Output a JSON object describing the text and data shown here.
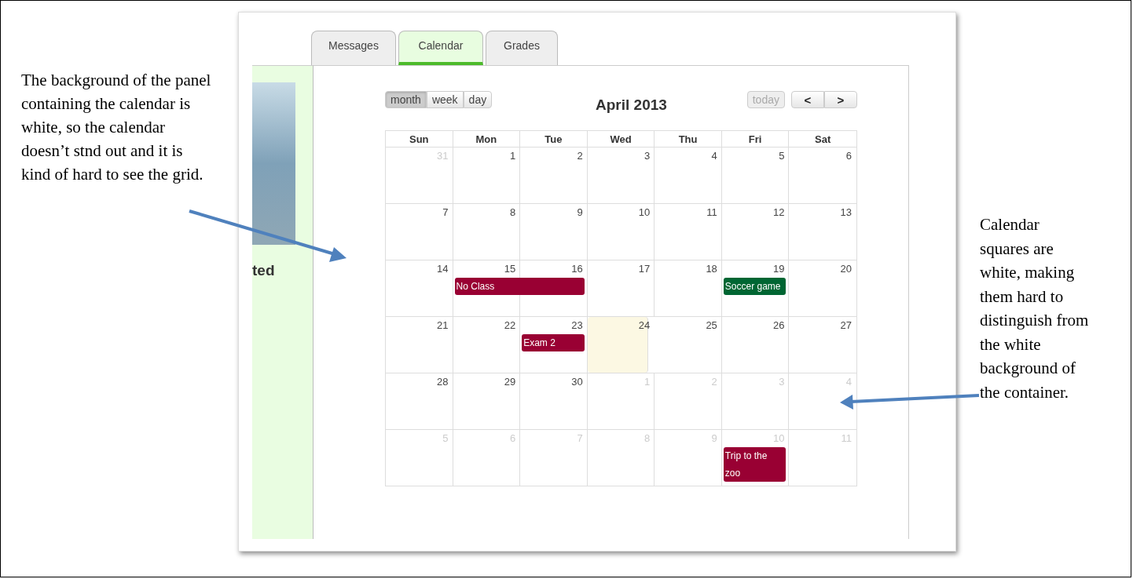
{
  "annotations": [
    {
      "text": "The background of the panel containing the calendar is white, so the calendar doesn’t stnd out and it is kind of hard to see the grid."
    },
    {
      "text": "Calendar squares are white, making them hard to distinguish from the white background of the container."
    }
  ],
  "tabs": [
    {
      "label": "Messages",
      "selected": false
    },
    {
      "label": "Calendar",
      "selected": true
    },
    {
      "label": "Grades",
      "selected": false
    }
  ],
  "sidebar": {
    "heading": "ted"
  },
  "calendar": {
    "view_buttons": [
      {
        "label": "month",
        "selected": true
      },
      {
        "label": "week",
        "selected": false
      },
      {
        "label": "day",
        "selected": false
      }
    ],
    "title": "April 2013",
    "today_button": {
      "label": "today",
      "disabled": true
    },
    "prev_button": "<",
    "next_button": ">",
    "weekdays": [
      "Sun",
      "Mon",
      "Tue",
      "Wed",
      "Thu",
      "Fri",
      "Sat"
    ],
    "weeks": [
      {
        "days": [
          {
            "day": "31",
            "other_month": true,
            "today": false
          },
          {
            "day": "1",
            "other_month": false,
            "today": false
          },
          {
            "day": "2",
            "other_month": false,
            "today": false
          },
          {
            "day": "3",
            "other_month": false,
            "today": false
          },
          {
            "day": "4",
            "other_month": false,
            "today": false
          },
          {
            "day": "5",
            "other_month": false,
            "today": false
          },
          {
            "day": "6",
            "other_month": false,
            "today": false
          }
        ]
      },
      {
        "days": [
          {
            "day": "7",
            "other_month": false,
            "today": false
          },
          {
            "day": "8",
            "other_month": false,
            "today": false
          },
          {
            "day": "9",
            "other_month": false,
            "today": false
          },
          {
            "day": "10",
            "other_month": false,
            "today": false
          },
          {
            "day": "11",
            "other_month": false,
            "today": false
          },
          {
            "day": "12",
            "other_month": false,
            "today": false
          },
          {
            "day": "13",
            "other_month": false,
            "today": false
          }
        ]
      },
      {
        "days": [
          {
            "day": "14",
            "other_month": false,
            "today": false
          },
          {
            "day": "15",
            "other_month": false,
            "today": false,
            "event": {
              "title": "No Class",
              "color": "#990033",
              "continues_next_day": true
            }
          },
          {
            "day": "16",
            "other_month": false,
            "today": false
          },
          {
            "day": "17",
            "other_month": false,
            "today": false
          },
          {
            "day": "18",
            "other_month": false,
            "today": false
          },
          {
            "day": "19",
            "other_month": false,
            "today": false,
            "event": {
              "title": "Soccer game",
              "color": "#006633",
              "continues_next_day": false
            }
          },
          {
            "day": "20",
            "other_month": false,
            "today": false
          }
        ]
      },
      {
        "days": [
          {
            "day": "21",
            "other_month": false,
            "today": false
          },
          {
            "day": "22",
            "other_month": false,
            "today": false
          },
          {
            "day": "23",
            "other_month": false,
            "today": false,
            "event": {
              "title": "Exam 2",
              "color": "#990033",
              "continues_next_day": false
            }
          },
          {
            "day": "24",
            "other_month": false,
            "today": true
          },
          {
            "day": "25",
            "other_month": false,
            "today": false
          },
          {
            "day": "26",
            "other_month": false,
            "today": false
          },
          {
            "day": "27",
            "other_month": false,
            "today": false
          }
        ]
      },
      {
        "days": [
          {
            "day": "28",
            "other_month": false,
            "today": false
          },
          {
            "day": "29",
            "other_month": false,
            "today": false
          },
          {
            "day": "30",
            "other_month": false,
            "today": false
          },
          {
            "day": "1",
            "other_month": true,
            "today": false
          },
          {
            "day": "2",
            "other_month": true,
            "today": false
          },
          {
            "day": "3",
            "other_month": true,
            "today": false
          },
          {
            "day": "4",
            "other_month": true,
            "today": false
          }
        ]
      },
      {
        "days": [
          {
            "day": "5",
            "other_month": true,
            "today": false
          },
          {
            "day": "6",
            "other_month": true,
            "today": false
          },
          {
            "day": "7",
            "other_month": true,
            "today": false
          },
          {
            "day": "8",
            "other_month": true,
            "today": false
          },
          {
            "day": "9",
            "other_month": true,
            "today": false
          },
          {
            "day": "10",
            "other_month": true,
            "today": false,
            "event": {
              "title": "Trip to the zoo",
              "color": "#990033",
              "continues_next_day": false
            }
          },
          {
            "day": "11",
            "other_month": true,
            "today": false
          }
        ]
      }
    ]
  }
}
